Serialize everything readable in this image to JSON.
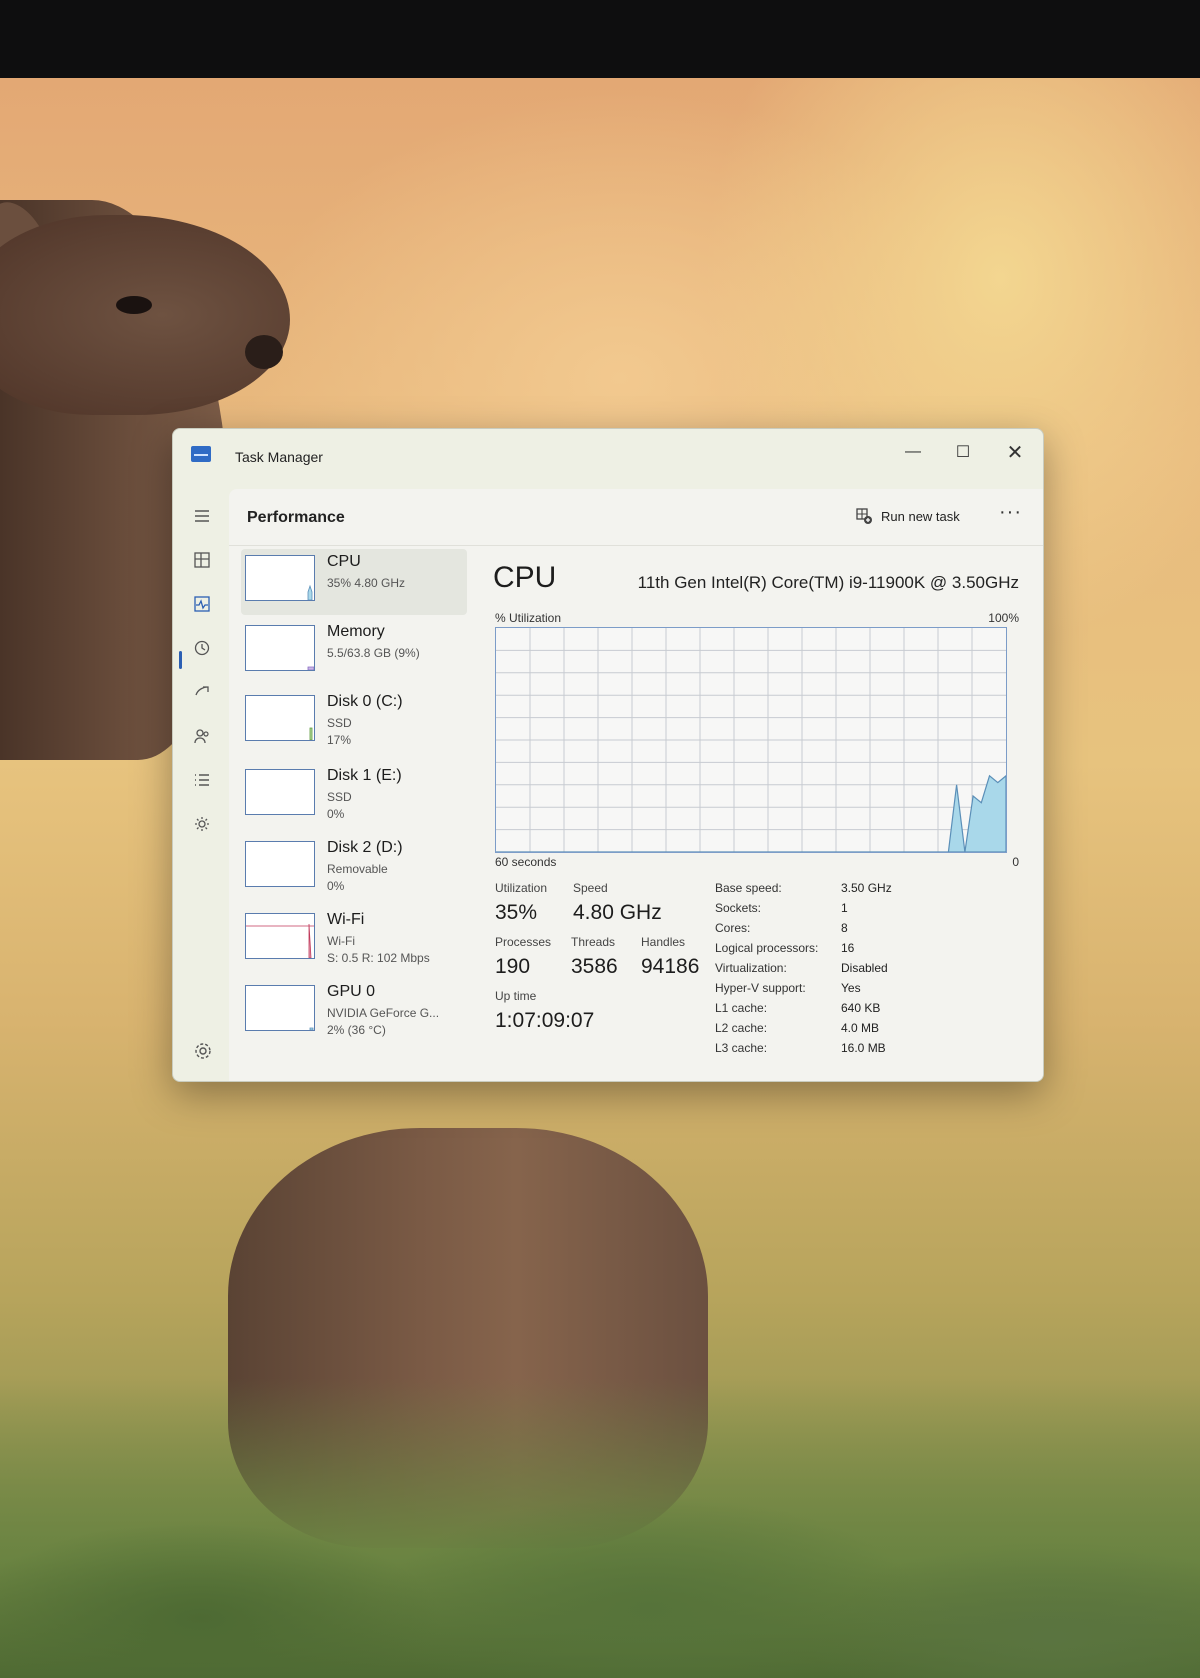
{
  "window": {
    "title": "Task Manager"
  },
  "header": {
    "page_title": "Performance",
    "run_new_task": "Run new task",
    "more": "···"
  },
  "nav_icons": [
    "hamburger-icon",
    "processes-icon",
    "performance-icon",
    "app-history-icon",
    "startup-apps-icon",
    "users-icon",
    "details-icon",
    "services-icon"
  ],
  "sidebar": {
    "items": [
      {
        "name": "CPU",
        "sub1": "35% 4.80 GHz",
        "sub2": ""
      },
      {
        "name": "Memory",
        "sub1": "5.5/63.8 GB (9%)",
        "sub2": ""
      },
      {
        "name": "Disk 0 (C:)",
        "sub1": "SSD",
        "sub2": "17%"
      },
      {
        "name": "Disk 1 (E:)",
        "sub1": "SSD",
        "sub2": "0%"
      },
      {
        "name": "Disk 2 (D:)",
        "sub1": "Removable",
        "sub2": "0%"
      },
      {
        "name": "Wi-Fi",
        "sub1": "Wi-Fi",
        "sub2": "S: 0.5 R: 102 Mbps"
      },
      {
        "name": "GPU 0",
        "sub1": "NVIDIA GeForce G...",
        "sub2": "2% (36 °C)"
      }
    ]
  },
  "detail": {
    "title": "CPU",
    "model": "11th Gen Intel(R) Core(TM) i9-11900K @ 3.50GHz",
    "graph_label": "% Utilization",
    "graph_max": "100%",
    "time_label": "60 seconds",
    "time_zero": "0",
    "stats": {
      "utilization_label": "Utilization",
      "utilization": "35%",
      "speed_label": "Speed",
      "speed": "4.80 GHz",
      "processes_label": "Processes",
      "processes": "190",
      "threads_label": "Threads",
      "threads": "3586",
      "handles_label": "Handles",
      "handles": "94186",
      "uptime_label": "Up time",
      "uptime": "1:07:09:07"
    },
    "specs": [
      {
        "key": "Base speed:",
        "value": "3.50 GHz"
      },
      {
        "key": "Sockets:",
        "value": "1"
      },
      {
        "key": "Cores:",
        "value": "8"
      },
      {
        "key": "Logical processors:",
        "value": "16"
      },
      {
        "key": "Virtualization:",
        "value": "Disabled"
      },
      {
        "key": "Hyper-V support:",
        "value": "Yes"
      },
      {
        "key": "L1 cache:",
        "value": "640 KB"
      },
      {
        "key": "L2 cache:",
        "value": "4.0 MB"
      },
      {
        "key": "L3 cache:",
        "value": "16.0 MB"
      }
    ]
  },
  "cpu_history_percent": [
    0,
    0,
    0,
    0,
    0,
    0,
    0,
    0,
    0,
    0,
    0,
    0,
    0,
    0,
    0,
    0,
    0,
    0,
    0,
    0,
    0,
    0,
    0,
    0,
    0,
    0,
    0,
    0,
    0,
    0,
    0,
    0,
    0,
    0,
    0,
    0,
    0,
    0,
    0,
    0,
    0,
    0,
    0,
    0,
    0,
    0,
    0,
    0,
    0,
    0,
    0,
    0,
    0,
    0,
    0,
    0,
    30,
    0,
    25,
    22,
    34,
    31,
    34
  ],
  "colors": {
    "accent": "#2b5fb3",
    "graph_fill": "#a9d8ea",
    "graph_line": "#5b8fb8",
    "grid": "#c7cbd1"
  }
}
